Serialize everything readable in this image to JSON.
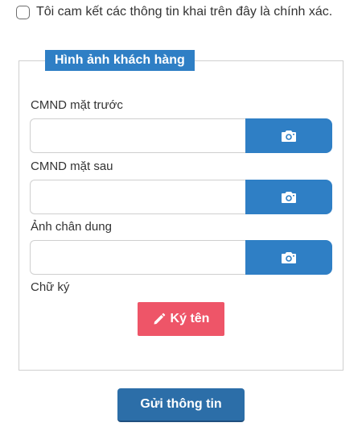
{
  "consent": {
    "text": "Tôi cam kết các thông tin khai trên đây là chính xác.",
    "checked": false
  },
  "panel": {
    "legend": "Hình ảnh khách hàng"
  },
  "fields": [
    {
      "label": "CMND mặt trước",
      "value": "",
      "icon": "camera-icon"
    },
    {
      "label": "CMND mặt sau",
      "value": "",
      "icon": "camera-icon"
    },
    {
      "label": "Ảnh chân dung",
      "value": "",
      "icon": "camera-icon"
    }
  ],
  "signature": {
    "label": "Chữ ký",
    "button_label": "Ký tên",
    "icon": "pencil-icon"
  },
  "submit": {
    "label": "Gửi thông tin"
  },
  "colors": {
    "primary": "#2f7fc5",
    "submit": "#2c6ea8",
    "sign": "#ee5568",
    "border": "#cfcfcf"
  }
}
